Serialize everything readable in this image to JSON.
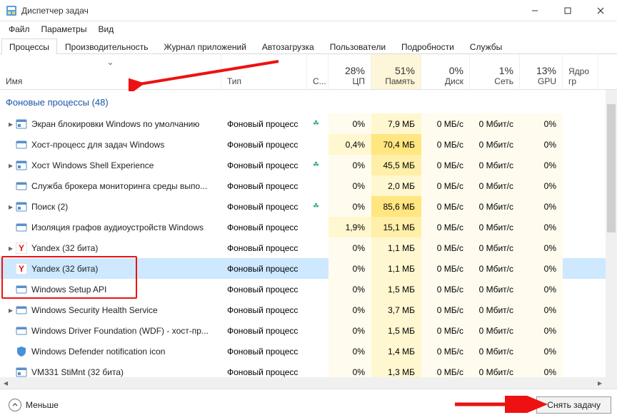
{
  "window": {
    "title": "Диспетчер задач"
  },
  "menu": {
    "file": "Файл",
    "options": "Параметры",
    "view": "Вид"
  },
  "tabs": {
    "processes": "Процессы",
    "performance": "Производительность",
    "apphistory": "Журнал приложений",
    "startup": "Автозагрузка",
    "users": "Пользователи",
    "details": "Подробности",
    "services": "Службы"
  },
  "columns": {
    "name": "Имя",
    "type": "Тип",
    "status": "С...",
    "cpu_pct": "28%",
    "cpu": "ЦП",
    "mem_pct": "51%",
    "mem": "Память",
    "disk_pct": "0%",
    "disk": "Диск",
    "net_pct": "1%",
    "net": "Сеть",
    "gpu_pct": "13%",
    "gpu": "GPU",
    "gpue": "Ядро гр"
  },
  "group": {
    "bg_title": "Фоновые процессы (48)"
  },
  "rows": [
    {
      "exp": true,
      "icon": "app",
      "name": "Экран блокировки Windows по умолчанию",
      "type": "Фоновый процесс",
      "leaf": true,
      "cpu": "0%",
      "mem": "7,9 МБ",
      "disk": "0 МБ/с",
      "net": "0 Мбит/с",
      "gpu": "0%",
      "heat_mem": 1
    },
    {
      "exp": false,
      "icon": "service",
      "name": "Хост-процесс для задач Windows",
      "type": "Фоновый процесс",
      "leaf": false,
      "cpu": "0,4%",
      "mem": "70,4 МБ",
      "disk": "0 МБ/с",
      "net": "0 Мбит/с",
      "gpu": "0%",
      "heat_cpu": 1,
      "heat_mem": 3
    },
    {
      "exp": true,
      "icon": "app",
      "name": "Хост Windows Shell Experience",
      "type": "Фоновый процесс",
      "leaf": true,
      "cpu": "0%",
      "mem": "45,5 МБ",
      "disk": "0 МБ/с",
      "net": "0 Мбит/с",
      "gpu": "0%",
      "heat_mem": 2
    },
    {
      "exp": false,
      "icon": "service",
      "name": "Служба брокера мониторинга среды выпо...",
      "type": "Фоновый процесс",
      "leaf": false,
      "cpu": "0%",
      "mem": "2,0 МБ",
      "disk": "0 МБ/с",
      "net": "0 Мбит/с",
      "gpu": "0%",
      "heat_mem": 1
    },
    {
      "exp": true,
      "icon": "app",
      "name": "Поиск (2)",
      "type": "Фоновый процесс",
      "leaf": true,
      "cpu": "0%",
      "mem": "85,6 МБ",
      "disk": "0 МБ/с",
      "net": "0 Мбит/с",
      "gpu": "0%",
      "heat_mem": 3
    },
    {
      "exp": false,
      "icon": "service",
      "name": "Изоляция графов аудиоустройств Windows",
      "type": "Фоновый процесс",
      "leaf": false,
      "cpu": "1,9%",
      "mem": "15,1 МБ",
      "disk": "0 МБ/с",
      "net": "0 Мбит/с",
      "gpu": "0%",
      "heat_cpu": 1,
      "heat_mem": 2
    },
    {
      "exp": true,
      "icon": "yandex",
      "name": "Yandex (32 бита)",
      "type": "Фоновый процесс",
      "leaf": false,
      "cpu": "0%",
      "mem": "1,1 МБ",
      "disk": "0 МБ/с",
      "net": "0 Мбит/с",
      "gpu": "0%",
      "heat_mem": 1
    },
    {
      "exp": false,
      "icon": "yandex",
      "name": "Yandex (32 бита)",
      "type": "Фоновый процесс",
      "leaf": false,
      "cpu": "0%",
      "mem": "1,1 МБ",
      "disk": "0 МБ/с",
      "net": "0 Мбит/с",
      "gpu": "0%",
      "sel": true,
      "heat_mem": 1
    },
    {
      "exp": false,
      "icon": "service",
      "name": "Windows Setup API",
      "type": "Фоновый процесс",
      "leaf": false,
      "cpu": "0%",
      "mem": "1,5 МБ",
      "disk": "0 МБ/с",
      "net": "0 Мбит/с",
      "gpu": "0%",
      "heat_mem": 1
    },
    {
      "exp": true,
      "icon": "service",
      "name": "Windows Security Health Service",
      "type": "Фоновый процесс",
      "leaf": false,
      "cpu": "0%",
      "mem": "3,7 МБ",
      "disk": "0 МБ/с",
      "net": "0 Мбит/с",
      "gpu": "0%",
      "heat_mem": 1
    },
    {
      "exp": false,
      "icon": "service",
      "name": "Windows Driver Foundation (WDF) - хост-пр...",
      "type": "Фоновый процесс",
      "leaf": false,
      "cpu": "0%",
      "mem": "1,5 МБ",
      "disk": "0 МБ/с",
      "net": "0 Мбит/с",
      "gpu": "0%",
      "heat_mem": 1
    },
    {
      "exp": false,
      "icon": "shield",
      "name": "Windows Defender notification icon",
      "type": "Фоновый процесс",
      "leaf": false,
      "cpu": "0%",
      "mem": "1,4 МБ",
      "disk": "0 МБ/с",
      "net": "0 Мбит/с",
      "gpu": "0%",
      "heat_mem": 1
    },
    {
      "exp": false,
      "icon": "app",
      "name": "VM331 StiMnt (32 бита)",
      "type": "Фоновый процесс",
      "leaf": false,
      "cpu": "0%",
      "mem": "1,3 МБ",
      "disk": "0 МБ/с",
      "net": "0 Мбит/с",
      "gpu": "0%",
      "heat_mem": 1
    }
  ],
  "footer": {
    "less": "Меньше",
    "endtask": "Снять задачу"
  }
}
